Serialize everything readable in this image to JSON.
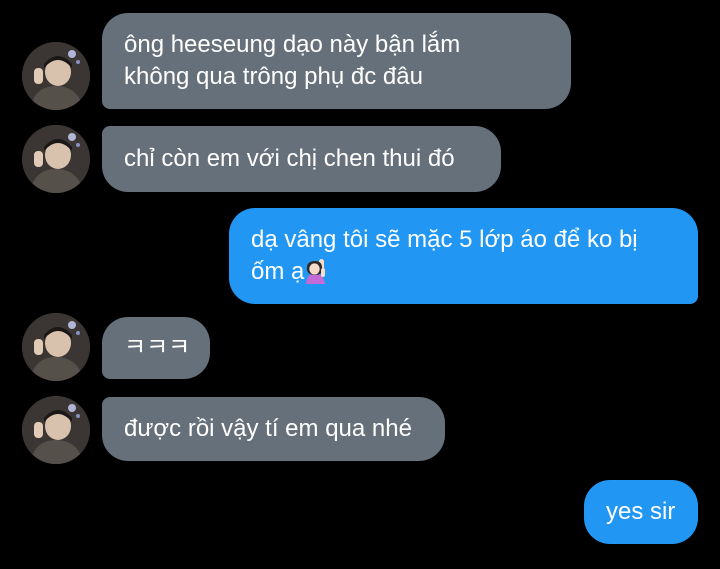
{
  "chat": {
    "colors": {
      "background": "#000000",
      "incoming_bubble": "#66707a",
      "outgoing_bubble": "#2196f3",
      "text": "#ffffff"
    },
    "messages": [
      {
        "direction": "incoming",
        "lines": [
          "ông heeseung dạo này bận lắm",
          "không qua trông phụ đc đâu"
        ]
      },
      {
        "direction": "incoming",
        "lines": [
          "chỉ còn em với chị chen thui đó"
        ]
      },
      {
        "direction": "outgoing",
        "lines": [
          "dạ vâng tôi sẽ mặc 5 lớp áo để ko bị",
          "ốm ạ"
        ],
        "emoji": "woman-raising-hand"
      },
      {
        "direction": "incoming",
        "lines": [
          "ㅋㅋㅋ"
        ]
      },
      {
        "direction": "incoming",
        "lines": [
          "được rồi vậy tí em qua nhé"
        ]
      },
      {
        "direction": "outgoing",
        "lines": [
          "yes sir"
        ]
      }
    ]
  }
}
